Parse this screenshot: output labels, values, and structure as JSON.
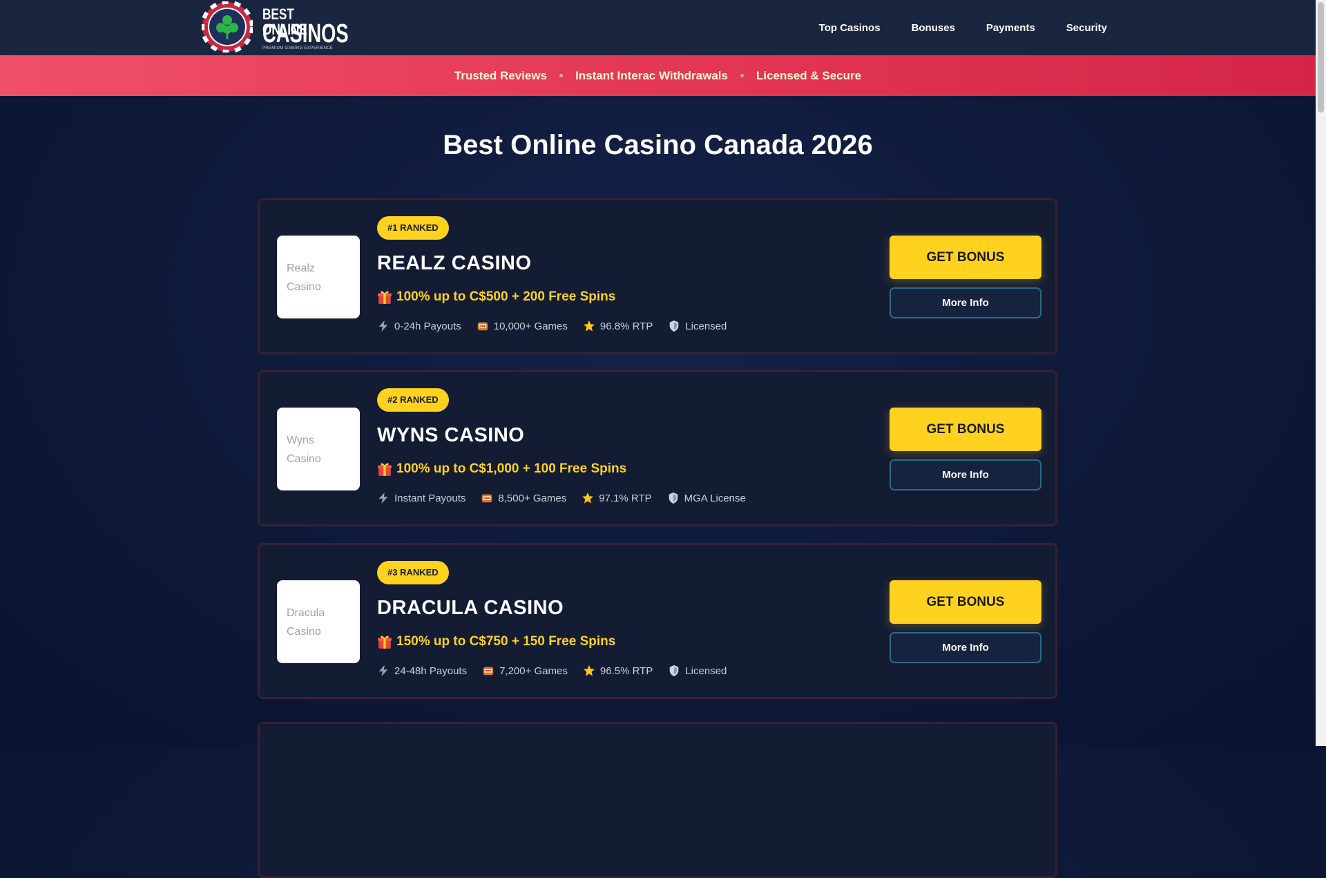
{
  "header": {
    "logo": {
      "line1": "BEST ONLINE",
      "line2": "CASINOS",
      "tagline": "PREMIUM GAMING EXPERIENCE"
    },
    "nav": [
      {
        "label": "Top Casinos"
      },
      {
        "label": "Bonuses"
      },
      {
        "label": "Payments"
      },
      {
        "label": "Security"
      }
    ]
  },
  "trust_bar": {
    "items": [
      "Trusted Reviews",
      "Instant Interac Withdrawals",
      "Licensed & Secure"
    ]
  },
  "main": {
    "title": "Best Online Casino Canada 2026",
    "casinos": [
      {
        "rank": "#1 RANKED",
        "name": "REALZ CASINO",
        "logo_alt": "Realz Casino",
        "bonus": "100% up to C$500 + 200 Free Spins",
        "features": {
          "payout": "0-24h Payouts",
          "games": "10,000+ Games",
          "rtp": "96.8% RTP",
          "license": "Licensed"
        },
        "cta": "GET BONUS",
        "info": "More Info"
      },
      {
        "rank": "#2 RANKED",
        "name": "WYNS CASINO",
        "logo_alt": "Wyns Casino",
        "bonus": "100% up to C$1,000 + 100 Free Spins",
        "features": {
          "payout": "Instant Payouts",
          "games": "8,500+ Games",
          "rtp": "97.1% RTP",
          "license": "MGA License"
        },
        "cta": "GET BONUS",
        "info": "More Info"
      },
      {
        "rank": "#3 RANKED",
        "name": "DRACULA CASINO",
        "logo_alt": "Dracula Casino",
        "bonus": "150% up to C$750 + 150 Free Spins",
        "features": {
          "payout": "24-48h Payouts",
          "games": "7,200+ Games",
          "rtp": "96.5% RTP",
          "license": "Licensed"
        },
        "cta": "GET BONUS",
        "info": "More Info"
      }
    ]
  },
  "colors": {
    "background": "#0e1938",
    "header": "#1a2640",
    "trust_bar": "#e53a56",
    "accent_yellow": "#ffd21f",
    "card": "#131c33",
    "info_border": "#2c6b86"
  },
  "icons": {
    "bonus": "gift-icon",
    "payout": "lightning-icon",
    "games": "slot-machine-icon",
    "rtp": "star-icon",
    "license": "shield-icon"
  }
}
